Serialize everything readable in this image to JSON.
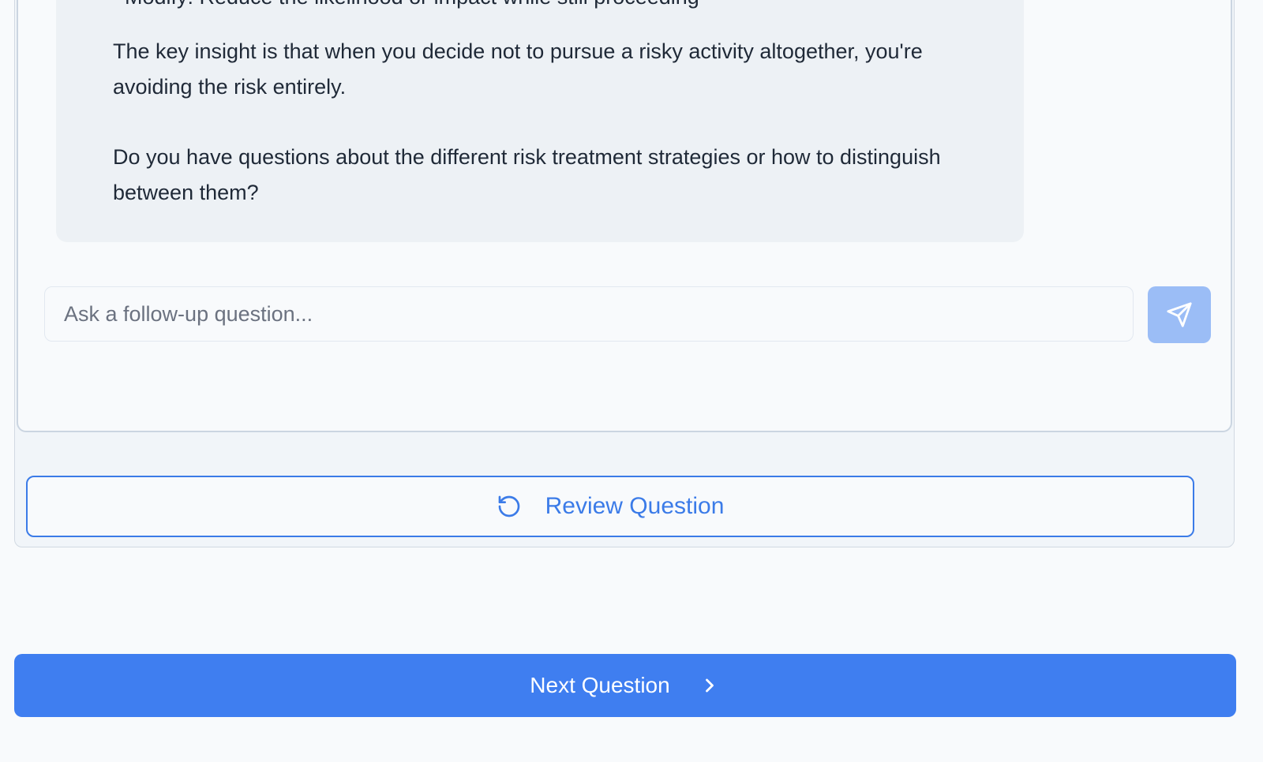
{
  "chat": {
    "partial_line": "• Modify: Reduce the likelihood or impact while still proceeding",
    "paragraph_1": "The key insight is that when you decide not to pursue a risky activity altogether, you're avoiding the risk entirely.",
    "paragraph_2": "Do you have questions about the different risk treatment strategies or how to distinguish between them?"
  },
  "followup": {
    "placeholder": "Ask a follow-up question...",
    "value": "",
    "send_icon": "send-icon"
  },
  "actions": {
    "review_label": "Review Question",
    "review_icon": "rotate-ccw-icon",
    "next_label": "Next Question",
    "next_icon": "chevron-right-icon"
  },
  "colors": {
    "accent": "#3f7ef0",
    "send_button_disabled": "#9bbdf6",
    "bubble_bg": "#edf1f5"
  }
}
